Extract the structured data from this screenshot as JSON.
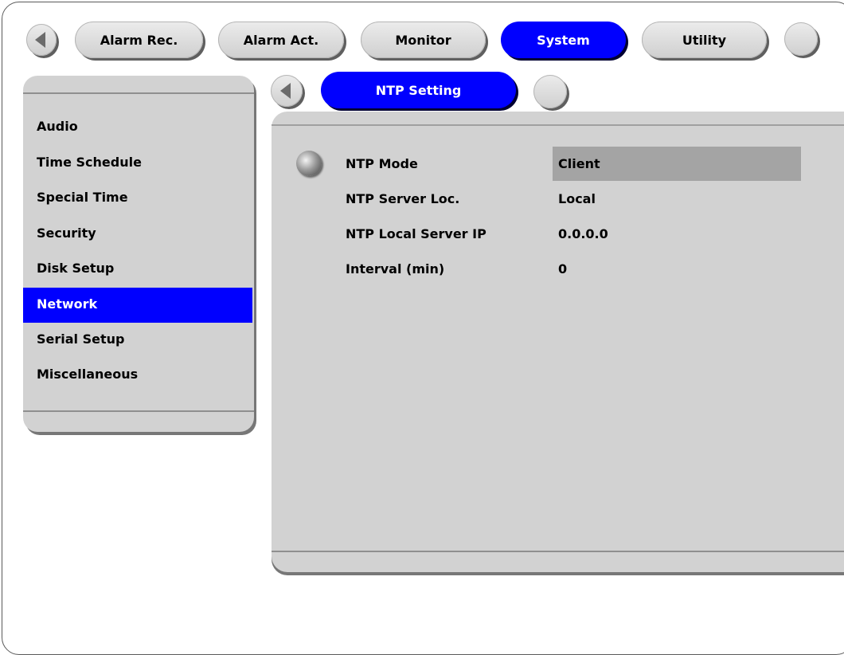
{
  "top_tabs": [
    {
      "label": "Alarm Rec.",
      "active": false
    },
    {
      "label": "Alarm Act.",
      "active": false
    },
    {
      "label": "Monitor",
      "active": false
    },
    {
      "label": "System",
      "active": true
    },
    {
      "label": "Utility",
      "active": false
    }
  ],
  "sub_tab": {
    "label": "NTP Setting"
  },
  "sidebar": {
    "items": [
      {
        "label": "Audio"
      },
      {
        "label": "Time Schedule"
      },
      {
        "label": "Special Time"
      },
      {
        "label": "Security"
      },
      {
        "label": "Disk Setup"
      },
      {
        "label": "Network",
        "selected": true
      },
      {
        "label": "Serial Setup"
      },
      {
        "label": "Miscellaneous"
      }
    ]
  },
  "settings": [
    {
      "label": "NTP Mode",
      "value": "Client",
      "focused": true
    },
    {
      "label": "NTP Server Loc.",
      "value": "Local"
    },
    {
      "label": "NTP Local Server IP",
      "value": "0.0.0.0"
    },
    {
      "label": "Interval (min)",
      "value": "0"
    }
  ],
  "colors": {
    "accent": "#0000ff",
    "panel": "#d2d2d2",
    "highlight": "#a4a4a4"
  }
}
